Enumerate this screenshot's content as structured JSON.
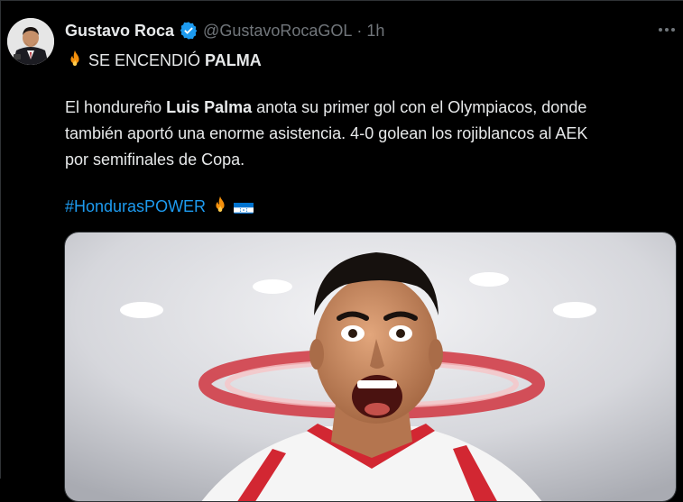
{
  "tweet": {
    "author": {
      "display_name": "Gustavo Roca",
      "handle": "@GustavoRocaGOL",
      "separator": "·",
      "time": "1h",
      "verified_icon": "verified-badge-icon"
    },
    "lines": {
      "headline_prefix": "SE ENCENDIÓ ",
      "headline_bold": "PALMA",
      "p1_a": "El hondureño ",
      "p1_bold": "Luis Palma",
      "p1_b": " anota su primer gol con el Olympiacos, donde",
      "p2": "también aportó una enorme asistencia. 4-0 golean los rojiblancos al AEK",
      "p3": "por semifinales de Copa.",
      "hashtag": "#HondurasPOWER"
    },
    "icons": [
      "fire-emoji-icon",
      "honduras-flag-icon",
      "more-options-icon"
    ]
  },
  "colors": {
    "background": "#000000",
    "text": "#e7e9ea",
    "secondary": "#71767b",
    "link": "#1d9bf0",
    "verified": "#1d9bf0"
  }
}
